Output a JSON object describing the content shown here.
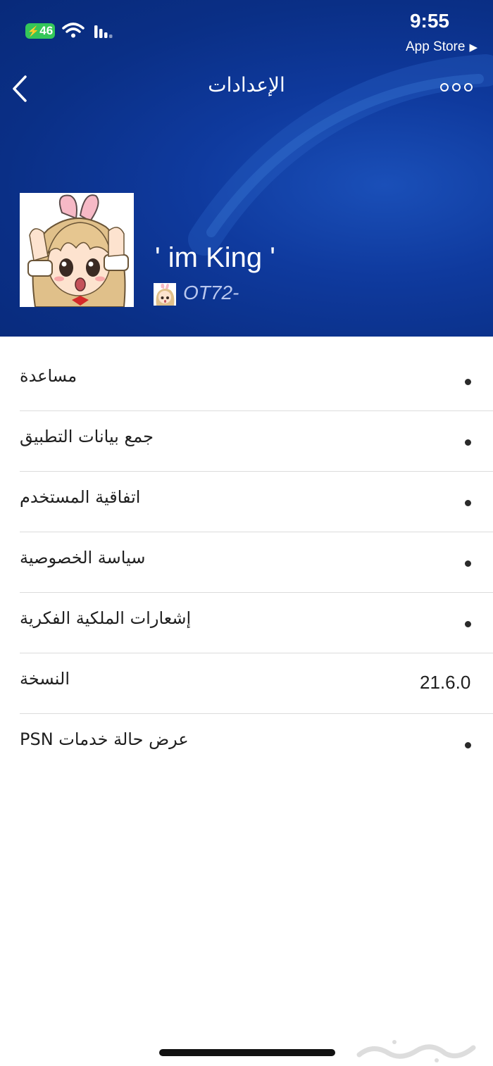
{
  "status_bar": {
    "battery": "46",
    "time": "9:55",
    "back_app": "App Store"
  },
  "nav": {
    "title": "الإعدادات",
    "back_icon": "chevron-left-icon",
    "more_icon": "more-dots-icon"
  },
  "profile": {
    "name": "' im King '",
    "online_id": "OT72-"
  },
  "settings": {
    "items": [
      {
        "label": "مساعدة"
      },
      {
        "label": "جمع بيانات التطبيق"
      },
      {
        "label": "اتفاقية المستخدم"
      },
      {
        "label": "سياسة الخصوصية"
      },
      {
        "label": "إشعارات الملكية الفكرية"
      },
      {
        "label": "النسخة",
        "value": "21.6.0"
      },
      {
        "label": "عرض حالة خدمات PSN"
      }
    ]
  },
  "colors": {
    "header_blue": "#0a2f86",
    "battery_green": "#34c759",
    "divider": "#dcdcdc"
  }
}
